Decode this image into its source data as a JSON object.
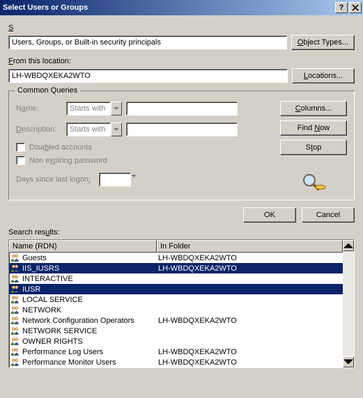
{
  "title": "Select Users or Groups",
  "labels": {
    "objectType": "Select this object type:",
    "fromLocation": "From this location:",
    "searchResults": "Search results:"
  },
  "objectType": {
    "value": "Users, Groups, or Built-in security principals",
    "button": "Object Types..."
  },
  "location": {
    "value": "LH-WBDQXEKA2WTO",
    "button": "Locations..."
  },
  "commonQueries": {
    "legend": "Common Queries",
    "nameLabel": "Name:",
    "nameMode": "Starts with",
    "descLabel": "Description:",
    "descMode": "Starts with",
    "disabled": "Disabled accounts",
    "nonExpiring": "Non expiring password",
    "daysLabel": "Days since last logon:"
  },
  "sideButtons": {
    "columns": "Columns...",
    "findNow": "Find Now",
    "stop": "Stop"
  },
  "okCancel": {
    "ok": "OK",
    "cancel": "Cancel"
  },
  "columns": {
    "name": "Name (RDN)",
    "folder": "In Folder"
  },
  "rows": [
    {
      "name": "Guests",
      "folder": "LH-WBDQXEKA2WTO",
      "selected": false
    },
    {
      "name": "IIS_IUSRS",
      "folder": "LH-WBDQXEKA2WTO",
      "selected": true
    },
    {
      "name": "INTERACTIVE",
      "folder": "",
      "selected": false
    },
    {
      "name": "IUSR",
      "folder": "",
      "selected": true
    },
    {
      "name": "LOCAL SERVICE",
      "folder": "",
      "selected": false
    },
    {
      "name": "NETWORK",
      "folder": "",
      "selected": false
    },
    {
      "name": "Network Configuration Operators",
      "folder": "LH-WBDQXEKA2WTO",
      "selected": false
    },
    {
      "name": "NETWORK SERVICE",
      "folder": "",
      "selected": false
    },
    {
      "name": "OWNER RIGHTS",
      "folder": "",
      "selected": false
    },
    {
      "name": "Performance Log Users",
      "folder": "LH-WBDQXEKA2WTO",
      "selected": false
    },
    {
      "name": "Performance Monitor Users",
      "folder": "LH-WBDQXEKA2WTO",
      "selected": false
    }
  ]
}
